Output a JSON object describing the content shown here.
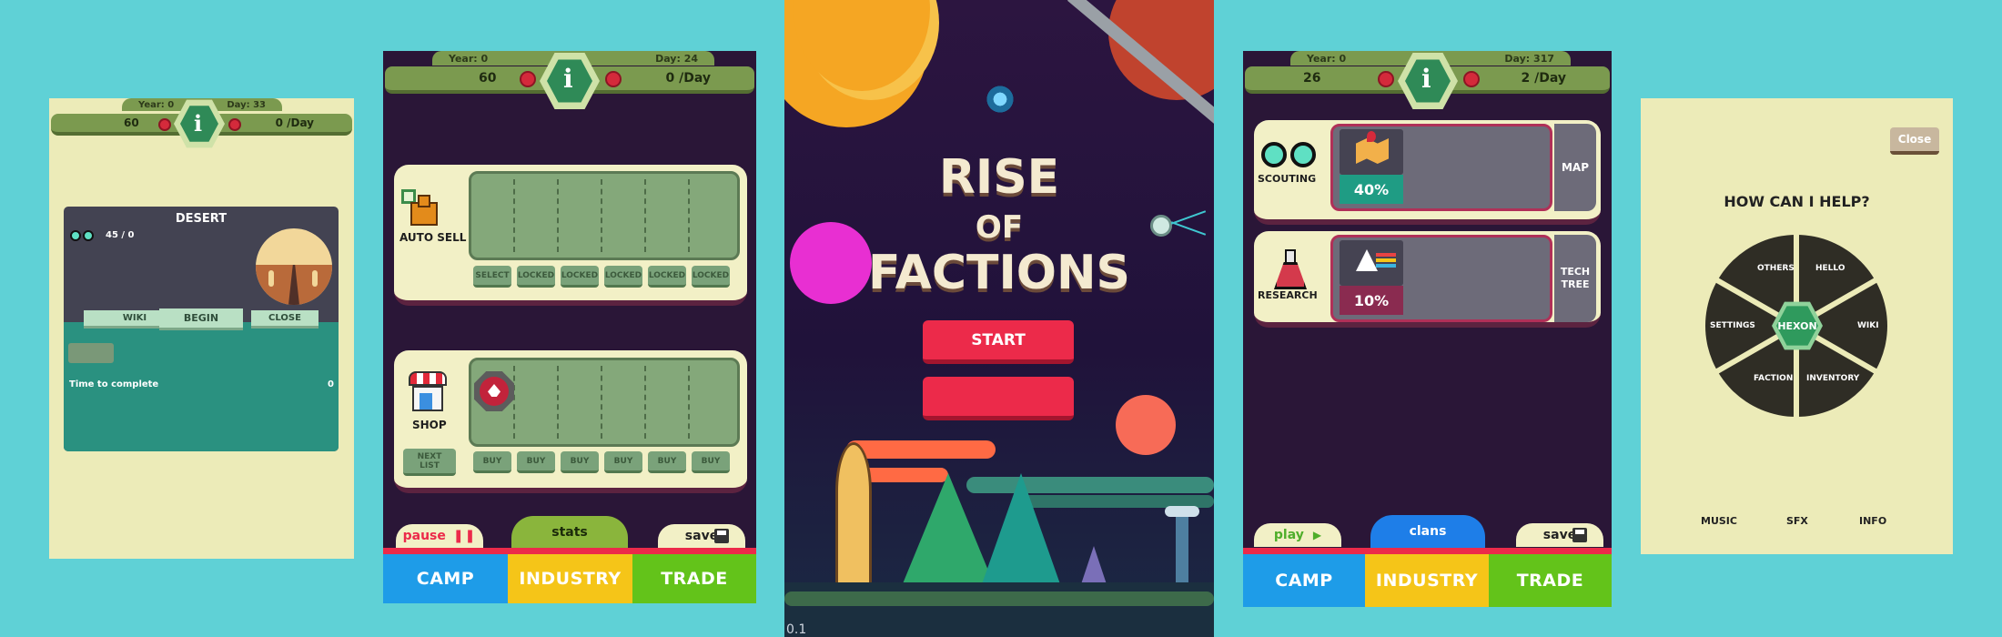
{
  "panel1": {
    "year": "Year: 0",
    "day": "Day: 33",
    "left_value": "60",
    "right_value": "0 /Day",
    "dialog": {
      "title": "DESERT",
      "counter": "45 / 0",
      "buttons": {
        "wiki": "WIKI",
        "begin": "BEGIN",
        "close": "CLOSE"
      },
      "time_label": "Time to complete",
      "time_value": "0"
    }
  },
  "panel2": {
    "year": "Year: 0",
    "day": "Day: 24",
    "left_value": "60",
    "right_value": "0 /Day",
    "autosell": {
      "label": "AUTO SELL",
      "slots": [
        "SELECT",
        "LOCKED",
        "LOCKED",
        "LOCKED",
        "LOCKED",
        "LOCKED"
      ]
    },
    "shop": {
      "label": "SHOP",
      "next": "NEXT LIST",
      "slots": [
        "BUY",
        "BUY",
        "BUY",
        "BUY",
        "BUY",
        "BUY"
      ]
    },
    "controls": {
      "pause": "pause",
      "stats": "stats",
      "save": "save"
    },
    "nav": {
      "camp": "CAMP",
      "industry": "INDUSTRY",
      "trade": "TRADE"
    }
  },
  "panel3": {
    "title_line1": "RISE",
    "title_line2": "OF",
    "title_line3": "FACTIONS",
    "start": "START",
    "second_button": "",
    "version": "0.1"
  },
  "panel4": {
    "year": "Year: 0",
    "day": "Day: 317",
    "left_value": "26",
    "right_value": "2 /Day",
    "scouting": {
      "label": "SCOUTING",
      "percent": "40%",
      "side": "MAP",
      "progress": 40
    },
    "research": {
      "label": "RESEARCH",
      "percent": "10%",
      "side": "TECH TREE",
      "progress": 10
    },
    "controls": {
      "play": "play",
      "clans": "clans",
      "save": "save"
    },
    "nav": {
      "camp": "CAMP",
      "industry": "INDUSTRY",
      "trade": "TRADE"
    }
  },
  "panel5": {
    "close": "Close",
    "title": "HOW CAN I HELP?",
    "wheel": {
      "center": "HEXON",
      "others": "OTHERS",
      "hello": "HELLO",
      "wiki": "WIKI",
      "inventory": "INVENTORY",
      "faction": "FACTION",
      "settings": "SETTINGS"
    },
    "footer": {
      "music": "MUSIC",
      "sfx": "SFX",
      "info": "INFO"
    }
  },
  "colors": {
    "background": "#5fd1d6",
    "card": "#f2f0c6",
    "dark": "#2a1637",
    "camp": "#1e9ce8",
    "industry": "#f5c518",
    "trade": "#63c31a",
    "red": "#ec2a4a"
  }
}
